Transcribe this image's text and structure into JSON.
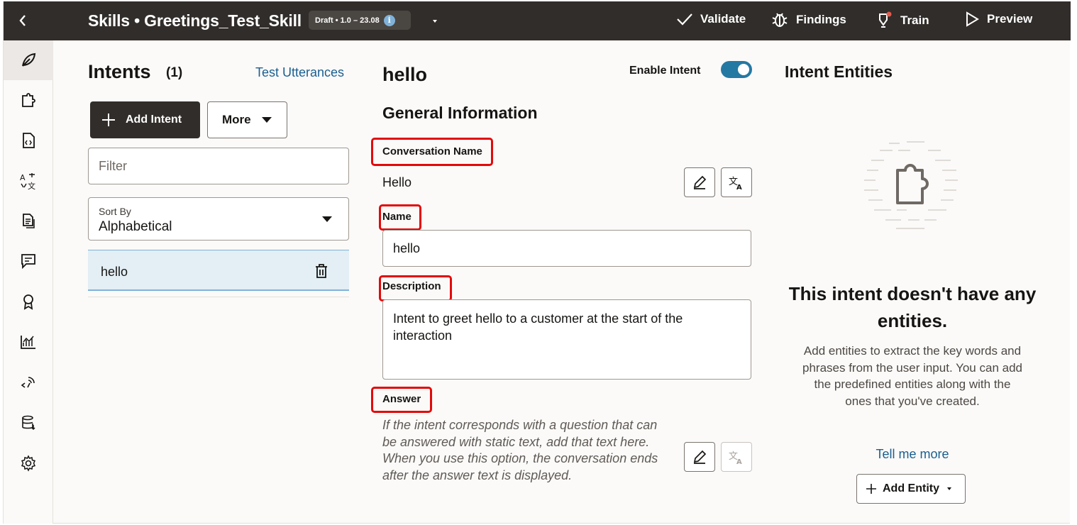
{
  "topbar": {
    "title": "Skills • Greetings_Test_Skill",
    "badge": "Draft • 1.0 – 23.08",
    "actions": {
      "validate": "Validate",
      "findings": "Findings",
      "train": "Train",
      "preview": "Preview"
    }
  },
  "sidebar": {
    "icons": [
      "leaf-icon",
      "puzzle-icon",
      "code-file-icon",
      "translate-icon",
      "documents-icon",
      "chat-icon",
      "badge-icon",
      "analytics-icon",
      "api-icon",
      "database-icon",
      "settings-icon"
    ]
  },
  "intents": {
    "heading": "Intents",
    "count": "(1)",
    "test_utterances": "Test Utterances",
    "add_intent": "Add Intent",
    "more": "More",
    "filter_placeholder": "Filter",
    "sort_label": "Sort By",
    "sort_value": "Alphabetical",
    "items": [
      {
        "name": "hello"
      }
    ]
  },
  "detail": {
    "title": "hello",
    "enable_label": "Enable Intent",
    "enabled": true,
    "general_heading": "General Information",
    "conversation_name_label": "Conversation Name",
    "conversation_name_value": "Hello",
    "name_label": "Name",
    "name_value": "hello",
    "description_label": "Description",
    "description_value": "Intent to greet hello to a customer at the start of the interaction",
    "answer_label": "Answer",
    "answer_help": "If the intent corresponds with a question that can be answered with static text, add that text here. When you use this option, the conversation ends after the answer text is displayed."
  },
  "entities": {
    "heading": "Intent Entities",
    "empty_title": "This intent doesn't have any entities.",
    "empty_desc": "Add entities to extract the key words and phrases from the user input. You can add the predefined entities along with the ones that you've created.",
    "tell_more": "Tell me more",
    "add_entity": "Add Entity"
  },
  "colors": {
    "topbar_bg": "#312d2a",
    "accent": "#2479a3",
    "link": "#1a5f90",
    "highlight_box": "#e3090a",
    "selected_row": "#e3eff5"
  }
}
